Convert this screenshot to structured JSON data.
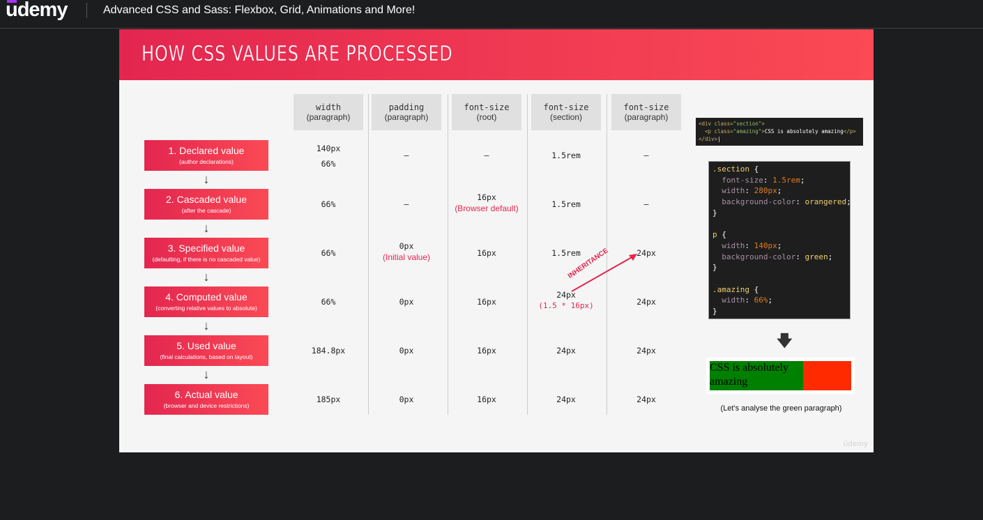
{
  "topbar": {
    "logo": "udemy",
    "course_title": "Advanced CSS and Sass: Flexbox, Grid, Animations and More!"
  },
  "slide": {
    "title": "HOW CSS VALUES ARE PROCESSED",
    "columns": [
      {
        "prop": "width",
        "sub": "(paragraph)"
      },
      {
        "prop": "padding",
        "sub": "(paragraph)"
      },
      {
        "prop": "font-size",
        "sub": "(root)"
      },
      {
        "prop": "font-size",
        "sub": "(section)"
      },
      {
        "prop": "font-size",
        "sub": "(paragraph)"
      }
    ],
    "steps": [
      {
        "title": "1. Declared value",
        "sub": "(author declarations)",
        "cells": [
          {
            "v": "140px",
            "v2": "66%"
          },
          {
            "v": "—"
          },
          {
            "v": "—"
          },
          {
            "v": "1.5rem"
          },
          {
            "v": "—"
          }
        ]
      },
      {
        "title": "2. Cascaded value",
        "sub": "(after the cascade)",
        "cells": [
          {
            "v": "66%"
          },
          {
            "v": "—"
          },
          {
            "v": "16px",
            "note": "(Browser default)"
          },
          {
            "v": "1.5rem"
          },
          {
            "v": "—"
          }
        ]
      },
      {
        "title": "3. Specified value",
        "sub": "(defaulting, if there is no cascaded value)",
        "cells": [
          {
            "v": "66%"
          },
          {
            "v": "0px",
            "note": "(Initial value)"
          },
          {
            "v": "16px"
          },
          {
            "v": "1.5rem"
          },
          {
            "v": "24px"
          }
        ]
      },
      {
        "title": "4. Computed value",
        "sub": "(converting relative values to absolute)",
        "cells": [
          {
            "v": "66%"
          },
          {
            "v": "0px"
          },
          {
            "v": "16px"
          },
          {
            "v": "24px",
            "note": "(1.5 * 16px)"
          },
          {
            "v": "24px"
          }
        ]
      },
      {
        "title": "5. Used value",
        "sub": "(final calculations, based on layout)",
        "cells": [
          {
            "v": "184.8px"
          },
          {
            "v": "0px"
          },
          {
            "v": "16px"
          },
          {
            "v": "24px"
          },
          {
            "v": "24px"
          }
        ]
      },
      {
        "title": "6. Actual value",
        "sub": "(browser and device restrictions)",
        "cells": [
          {
            "v": "185px"
          },
          {
            "v": "0px"
          },
          {
            "v": "16px"
          },
          {
            "v": "24px"
          },
          {
            "v": "24px"
          }
        ]
      }
    ],
    "inheritance_label": "INHERITANCE",
    "demo_text": "CSS is absolutely amazing",
    "caption": "(Let's analyse the green paragraph)",
    "watermark": "ûdemy"
  },
  "colors": {
    "accent": "#e3264f",
    "accent2": "#fb4a55",
    "topbar": "#1c1d1f"
  }
}
